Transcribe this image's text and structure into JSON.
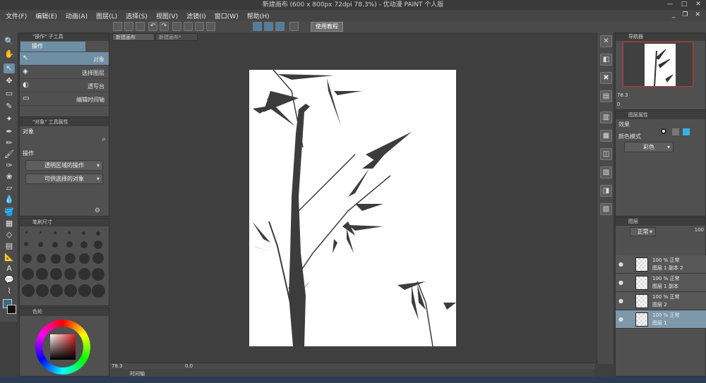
{
  "window": {
    "title": "新建画布 (600 x 800px 72dpi 78.3%) - 优动漫 PAINT 个人版"
  },
  "menu": [
    "文件(F)",
    "编辑(E)",
    "动画(A)",
    "图层(L)",
    "选择(S)",
    "视图(V)",
    "滤镜(I)",
    "窗口(W)",
    "帮助(H)"
  ],
  "command_bar": {
    "tutorial_label": "使用教程"
  },
  "doc_tabs": [
    "新建画布",
    "新建画布*"
  ],
  "left_panel": {
    "ops_header": "\"操作\" 子工具",
    "ops_title": "操作",
    "ops_items": [
      "对象",
      "选择图层",
      "透写台",
      "编辑时间轴"
    ],
    "props_header": "\"对象\" 工具属性",
    "props_title": "对象",
    "ops_section": "操作",
    "dd1": "透明区域的操作",
    "dd2": "可供选择的对象",
    "brush_header": "笔刷尺寸",
    "color_header": "色轮"
  },
  "navigator": {
    "header": "导航器",
    "zoom": "78.3",
    "angle": "0"
  },
  "layer_props": {
    "header": "图层属性",
    "effect_label": "效果",
    "color_mode_label": "颜色模式",
    "color_mode_value": "彩色"
  },
  "layers_panel": {
    "header": "图层",
    "blend_mode": "正常",
    "opacity": "100",
    "layers": [
      {
        "line1": "100 % 正常",
        "line2": "图层 1 副本 2"
      },
      {
        "line1": "100 % 正常",
        "line2": "图层 1 副本"
      },
      {
        "line1": "100 % 正常",
        "line2": "图层 2"
      },
      {
        "line1": "100 % 正常",
        "line2": "图层 1"
      }
    ]
  },
  "status": {
    "zoom": "78.3",
    "angle": "0.0",
    "timeline_tab": "时间轴"
  },
  "colors": {
    "accent": "#6f8fa5",
    "bg": "#3f3f3f",
    "panel": "#505050"
  }
}
